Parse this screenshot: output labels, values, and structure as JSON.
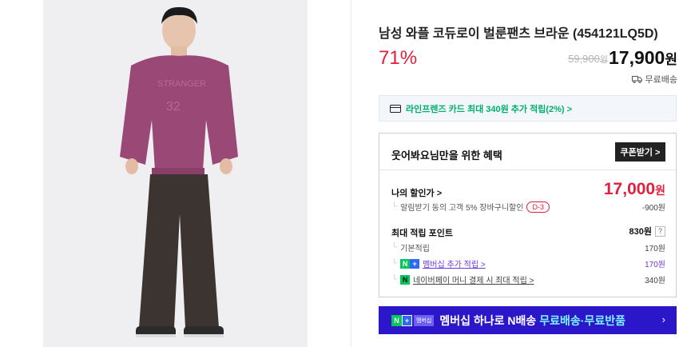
{
  "product": {
    "title": "남성 와플 코듀로이 벌룬팬츠 브라운 (454121LQ5D)",
    "discount_rate": "71%",
    "original_price": "59,900",
    "original_unit": "원",
    "price": "17,900",
    "price_unit": "원",
    "shipping": "무료배송"
  },
  "card_promo": {
    "text": "라인프렌즈 카드 최대 340원 추가 적립(2%) >"
  },
  "benefits": {
    "heading": "웃어봐요님만을 위한 혜택",
    "coupon_button": "쿠폰받기 >",
    "my_discount_label": "나의 할인가 >",
    "my_discount_price": "17,000",
    "my_discount_unit": "원",
    "alarm_text": "알림받기 동의 고객 5% 장바구니할인",
    "dday": "D-3",
    "alarm_value": "-900원",
    "points_label": "최대 적립 포인트",
    "points_value": "830원",
    "points_help": "?",
    "basic_label": "기본적립",
    "basic_value": "170원",
    "membership_label": "멤버십 추가 적립 >",
    "membership_value": "170원",
    "npay_label": "네이버페이 머니 결제 시 최대 적립 >",
    "npay_value": "340원"
  },
  "banner": {
    "badge_n": "N",
    "badge_plus": "+",
    "badge_text": "멤버십",
    "message": "멤버십 하나로 N배송",
    "highlight": "무료배송·무료반품",
    "chevron": "›"
  },
  "colors": {
    "sale_red": "#e1203d",
    "naver_green": "#03c75a",
    "banner_blue": "#2b17c9",
    "link_purple": "#6a3bd9"
  },
  "icons": {
    "truck": "truck-icon",
    "card": "card-icon"
  }
}
